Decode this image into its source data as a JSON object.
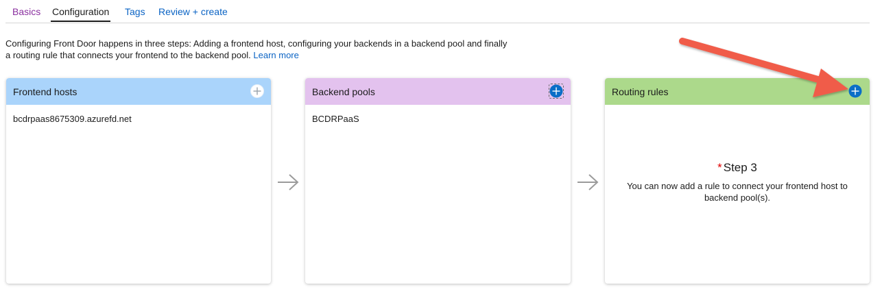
{
  "tabs": [
    {
      "label": "Basics",
      "state": "visited"
    },
    {
      "label": "Configuration",
      "state": "active"
    },
    {
      "label": "Tags",
      "state": "link"
    },
    {
      "label": "Review + create",
      "state": "link"
    }
  ],
  "intro": {
    "text": "Configuring Front Door happens in three steps: Adding a frontend host, configuring your backends in a backend pool and finally a routing rule that connects your frontend to the backend pool.",
    "learn_more": "Learn more"
  },
  "cards": {
    "frontend": {
      "title": "Frontend hosts",
      "item": "bcdrpaas8675309.azurefd.net",
      "color": "#aad4fb"
    },
    "backend": {
      "title": "Backend pools",
      "item": "BCDRPaaS",
      "color": "#e3c2ee"
    },
    "routing": {
      "title": "Routing rules",
      "color": "#acd98b",
      "step_required_mark": "*",
      "step_title": "Step 3",
      "step_desc": "You can now add a rule to connect your frontend host to backend pool(s)."
    }
  },
  "icons": {
    "add": "plus-circle-icon",
    "connector": "arrow-right-icon",
    "annotation": "red-pointer-arrow"
  },
  "colors": {
    "accent_blue": "#0a6ec7",
    "link": "#0a63c4",
    "visited": "#8a2f9f",
    "annotation_red": "#f05b4a"
  }
}
